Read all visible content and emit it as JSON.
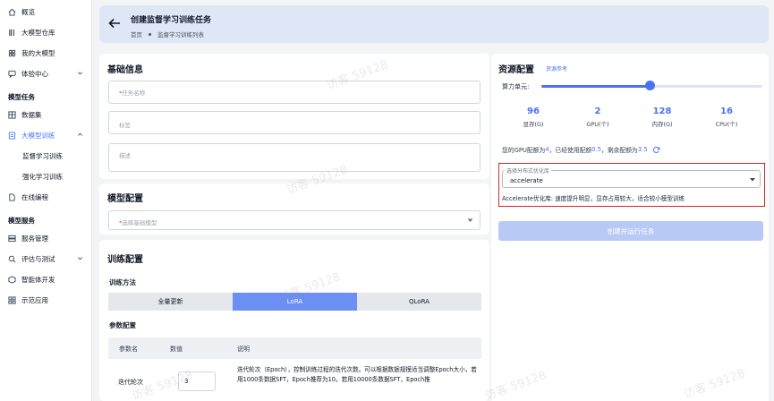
{
  "sidebar": {
    "items": [
      {
        "label": "概览",
        "icon": "home-icon"
      },
      {
        "label": "大模型仓库",
        "icon": "model-hub-icon"
      },
      {
        "label": "我的大模型",
        "icon": "my-model-icon"
      },
      {
        "label": "体验中心",
        "icon": "chat-icon"
      }
    ],
    "group_task": "模型任务",
    "task_items": [
      {
        "label": "数据集",
        "icon": "table-icon"
      },
      {
        "label": "大模型训练",
        "icon": "training-icon"
      }
    ],
    "training_sub": [
      {
        "label": "监督学习训练"
      },
      {
        "label": "强化学习训练"
      }
    ],
    "online_coding": {
      "label": "在线编程",
      "icon": "file-code-icon"
    },
    "group_service": "模型服务",
    "service_items": [
      {
        "label": "服务管理",
        "icon": "server-icon"
      },
      {
        "label": "评估与测试",
        "icon": "search-icon"
      },
      {
        "label": "智能体开发",
        "icon": "agent-icon"
      },
      {
        "label": "示范应用",
        "icon": "apps-icon"
      }
    ]
  },
  "header": {
    "title": "创建监督学习训练任务",
    "breadcrumb": [
      "首页",
      "监督学习训练列表"
    ]
  },
  "basic": {
    "title": "基础信息",
    "task_name_placeholder": "任务名称",
    "tags_placeholder": "标签",
    "desc_placeholder": "描述"
  },
  "model": {
    "title": "模型配置",
    "base_model_placeholder": "选择基础模型"
  },
  "training": {
    "title": "训练配置",
    "method_label": "训练方法",
    "methods": [
      "全量更新",
      "LoRA",
      "QLoRA"
    ],
    "selected_method": "LoRA",
    "params_label": "参数配置",
    "columns": [
      "参数名",
      "数值",
      "说明"
    ],
    "rows": [
      {
        "name": "迭代轮次",
        "value": "3",
        "desc": "迭代轮次（Epoch），控制训练过程的迭代次数。可以根据数据规模适当调整Epoch大小，若用1000条数据SFT，Epoch推荐为10。若用10000条数据SFT，Epoch推"
      }
    ]
  },
  "resources": {
    "title": "资源配置",
    "ref_link": "资源参考",
    "compute_label": "算力单元:",
    "slider_fraction": 0.49,
    "stats": [
      {
        "value": "96",
        "label": "显存(G)"
      },
      {
        "value": "2",
        "label": "GPU(个)"
      },
      {
        "value": "128",
        "label": "内存(G)"
      },
      {
        "value": "16",
        "label": "CPU(个)"
      }
    ],
    "quota_prefix": "您的GPU配额为",
    "quota_total": "4",
    "quota_used_prefix": "，已经使用配额",
    "quota_used": "0.5",
    "quota_left_prefix": "，剩余配额为",
    "quota_left": "3.5",
    "fs_legend": "选择分布式优化库",
    "fs_value": "accelerate",
    "fs_help": "Accelerate优化库: 速度提升明显，显存占用较大，适合较小模型训练",
    "run_button": "创建并运行任务"
  },
  "watermark": "访客 59128",
  "colors": {
    "accent": "#4a72f5",
    "highlight_border": "#dc2626",
    "header_bg": "#dfe6f5",
    "run_button_disabled": "#b9c9f5"
  }
}
